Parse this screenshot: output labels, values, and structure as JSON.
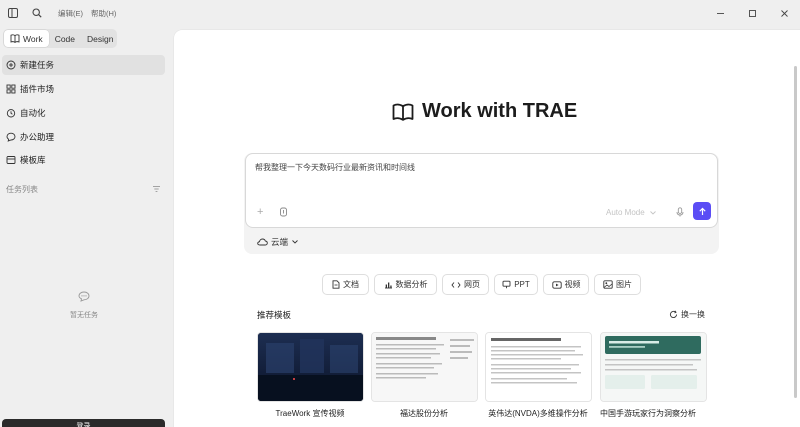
{
  "titlebar": {
    "menu": [
      "编辑(E)",
      "帮助(H)"
    ]
  },
  "mode_tabs": [
    {
      "label": "Work",
      "active": true
    },
    {
      "label": "Code",
      "active": false
    },
    {
      "label": "Design",
      "active": false
    }
  ],
  "sidebar": {
    "items": [
      {
        "label": "新建任务",
        "icon": "new-task-icon",
        "active": true
      },
      {
        "label": "插件市场",
        "icon": "plugin-icon",
        "active": false
      },
      {
        "label": "自动化",
        "icon": "clock-icon",
        "active": false
      },
      {
        "label": "办公助理",
        "icon": "chat-icon",
        "active": false
      },
      {
        "label": "模板库",
        "icon": "template-icon",
        "active": false
      }
    ],
    "section_label": "任务列表",
    "empty_label": "暂无任务",
    "bottom_button": "登录"
  },
  "main": {
    "hero_title": "Work with TRAE",
    "prompt_text": "帮我整理一下今天数码行业最新资讯和时间线",
    "mode_select": "Auto Mode",
    "cloud_label": "云端",
    "chips": [
      {
        "label": "文档",
        "icon": "doc-icon"
      },
      {
        "label": "数据分析",
        "icon": "chart-icon"
      },
      {
        "label": "网页",
        "icon": "code-icon"
      },
      {
        "label": "PPT",
        "icon": "ppt-icon"
      },
      {
        "label": "视频",
        "icon": "video-icon"
      },
      {
        "label": "图片",
        "icon": "image-icon"
      }
    ],
    "recommend_title": "推荐模板",
    "refresh_label": "换一换",
    "cards": [
      {
        "label": "TraeWork 宣传视频"
      },
      {
        "label": "福达股份分析"
      },
      {
        "label": "英伟达(NVDA)多维操作分析"
      },
      {
        "label": "中国手游玩家行为洞察分析"
      }
    ]
  },
  "colors": {
    "accent": "#5b4df5",
    "sidebar_bg": "#efefef",
    "main_bg": "#ffffff"
  }
}
